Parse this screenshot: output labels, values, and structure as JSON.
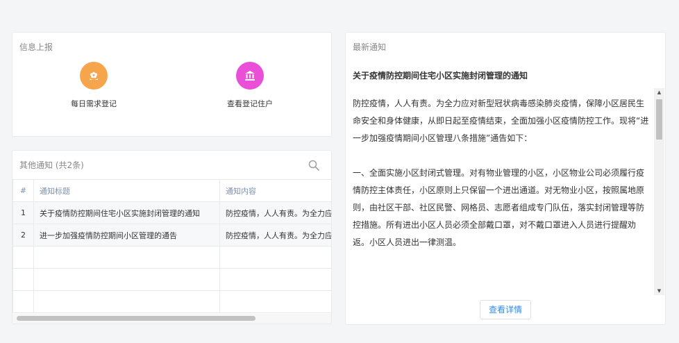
{
  "info_panel": {
    "title": "信息上报",
    "items": [
      {
        "label": "每日需求登记",
        "icon": "flower-icon",
        "color": "#f7a54c"
      },
      {
        "label": "查看登记住户",
        "icon": "building-icon",
        "color": "#e94fd7"
      }
    ]
  },
  "other_panel": {
    "title": "其他通知 (共2条)",
    "columns": [
      "#",
      "通知标题",
      "通知内容"
    ],
    "rows": [
      {
        "index": "1",
        "title": "关于疫情防控期间住宅小区实施封闭管理的通知",
        "content": "防控疫情，人人有责。为全力应对新型冠状病毒感染肺炎疫情"
      },
      {
        "index": "2",
        "title": "进一步加强疫情防控期间小区管理的通告",
        "content": "防控疫情，人人有责。为全力应对新型冠状病毒感染肺炎疫情"
      }
    ]
  },
  "latest_panel": {
    "title": "最新通知",
    "notice_title": "关于疫情防控期间住宅小区实施封闭管理的通知",
    "paragraphs": [
      "防控疫情，人人有责。为全力应对新型冠状病毒感染肺炎疫情，保障小区居民生命安全和身体健康，从即日起至疫情结束，全面加强小区疫情防控工作。现将“进一步加强疫情期间小区管理八条措施”通告如下：",
      "一、全面实施小区封闭式管理。对有物业管理的小区，小区物业公司必须履行疫情防控主体责任，小区原则上只保留一个进出通道。对无物业小区，按照属地原则，由社区干部、社区民警、网格员、志愿者组成专门队伍，落实封闭管理等防控措施。所有进出小区人员必须全部戴口罩，对不戴口罩进入人员进行提醒劝返。小区人员进出一律测温。"
    ],
    "detail_button": "查看详情"
  }
}
